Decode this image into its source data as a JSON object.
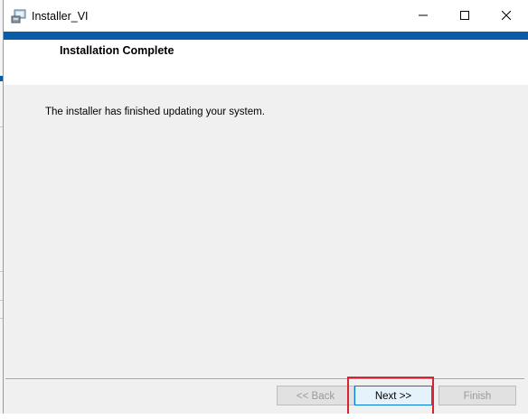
{
  "window": {
    "title": "Installer_VI",
    "header_title": "Installation Complete",
    "body_text": "The installer has finished updating your system."
  },
  "caption_buttons": {
    "minimize_icon": "minimize-icon",
    "maximize_icon": "maximize-icon",
    "close_icon": "close-icon"
  },
  "buttons": {
    "back": "<< Back",
    "next": "Next >>",
    "finish": "Finish"
  },
  "colors": {
    "accent": "#0b5ca8",
    "highlight": "#d62433"
  }
}
